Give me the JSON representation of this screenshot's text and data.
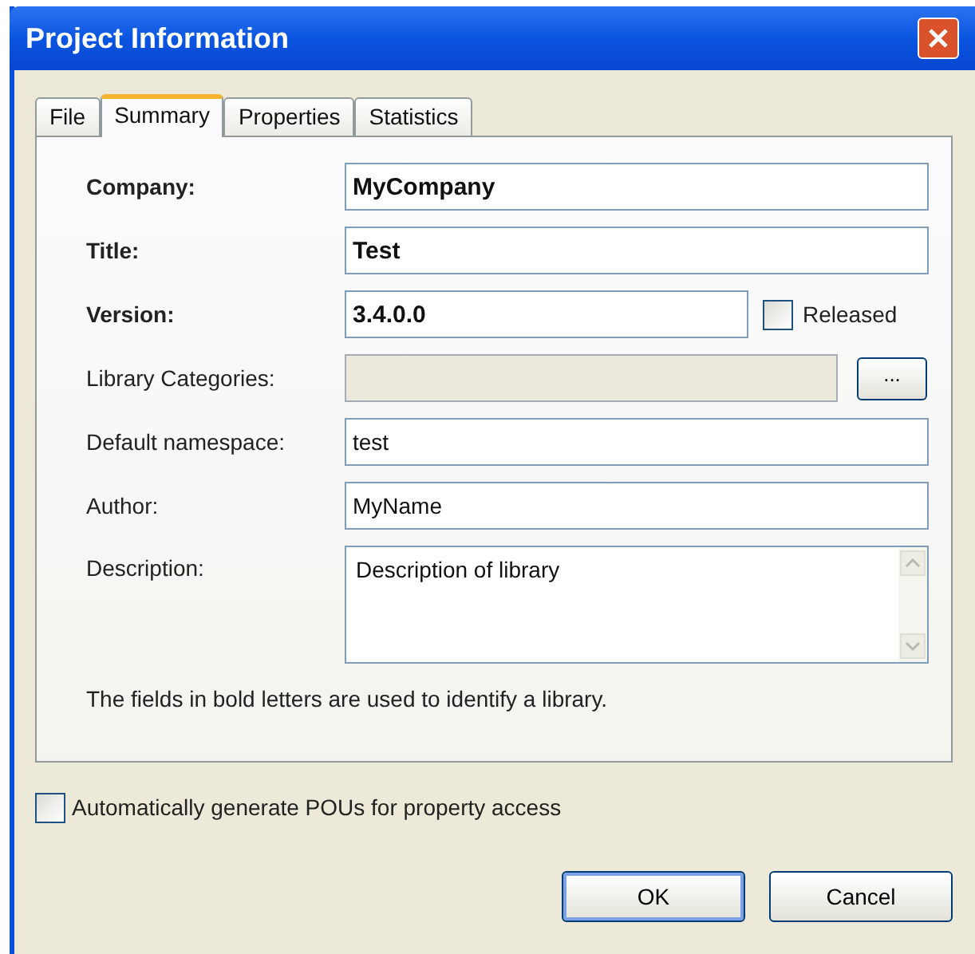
{
  "window": {
    "title": "Project Information"
  },
  "tabs": [
    {
      "label": "File",
      "selected": false
    },
    {
      "label": "Summary",
      "selected": true
    },
    {
      "label": "Properties",
      "selected": false
    },
    {
      "label": "Statistics",
      "selected": false
    }
  ],
  "fields": [
    {
      "kind": "text",
      "label": "Company:",
      "value": "MyCompany",
      "bold": true
    },
    {
      "kind": "text",
      "label": "Title:",
      "value": "Test",
      "bold": true
    },
    {
      "kind": "checkbox",
      "label": "Version:",
      "value": "3.4.0.0",
      "bold": true,
      "check_label": "Released",
      "checked": false
    },
    {
      "kind": "browse",
      "label": "Library Categories:",
      "bold": false,
      "button": "..."
    },
    {
      "kind": "text",
      "label": "Default namespace:",
      "value": "test",
      "bold": false
    },
    {
      "kind": "text",
      "label": "Author:",
      "value": "MyName",
      "bold": false
    },
    {
      "kind": "multiline",
      "label": "Description:",
      "value": "Description of library",
      "bold": false
    }
  ],
  "note": "The fields in bold letters are used to identify a library.",
  "auto_generate": {
    "label": "Automatically generate POUs for property access",
    "checked": false
  },
  "buttons": [
    "OK",
    "Cancel"
  ]
}
